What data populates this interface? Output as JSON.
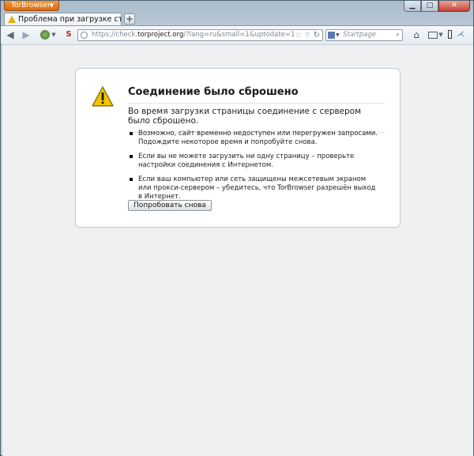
{
  "app": {
    "menu_button": "TorBrowser"
  },
  "tabs": [
    {
      "label": "Проблема при загрузке страницы",
      "icon": "warning-icon"
    }
  ],
  "navbar": {
    "url_prefix": "https://check.",
    "url_host": "torproject.org",
    "url_path": "/?lang=ru&small=1&uptodate=1",
    "search_placeholder": "Startpage",
    "noscript_label": "S"
  },
  "error": {
    "title": "Соединение было сброшено",
    "description": "Во время загрузки страницы соединение с сервером было сброшено.",
    "items": [
      "Возможно, сайт временно недоступен или перегружен запросами. Подождите некоторое время и попробуйте снова.",
      "Если вы не можете загрузить ни одну страницу – проверьте настройки соединения с Интернетом.",
      "Если ваш компьютер или сеть защищены межсетевым экраном или прокси-сервером – убедитесь, что TorBrowser разрешён выход в Интернет."
    ],
    "retry_label": "Попробовать снова"
  },
  "colors": {
    "app_button": "#e57f1f",
    "warning_yellow": "#f2c500",
    "content_bg": "#eff0f1"
  }
}
